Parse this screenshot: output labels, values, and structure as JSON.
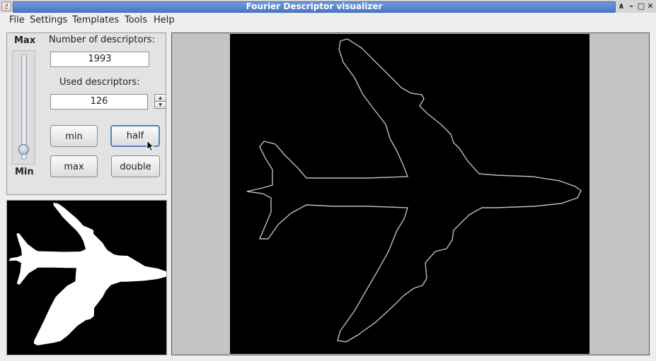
{
  "window": {
    "title": "Fourier Descriptor visualizer",
    "buttons": [
      "∧",
      "–",
      "□",
      "✕"
    ]
  },
  "menu": [
    "File",
    "Settings",
    "Templates",
    "Tools",
    "Help"
  ],
  "controls": {
    "slider_max_label": "Max",
    "slider_min_label": "Min",
    "number_label": "Number of descriptors:",
    "number_value": "1993",
    "used_label": "Used descriptors:",
    "used_value": "126",
    "btn_min": "min",
    "btn_half": "half",
    "btn_max": "max",
    "btn_double": "double"
  },
  "icons": {
    "app": "java-icon",
    "spin_up": "triangle-up-icon",
    "spin_down": "triangle-down-icon"
  },
  "colors": {
    "title_bar": "#4a78c6",
    "canvas_bg": "#000000",
    "contour": "#bdbdbd",
    "silhouette": "#ffffff"
  }
}
